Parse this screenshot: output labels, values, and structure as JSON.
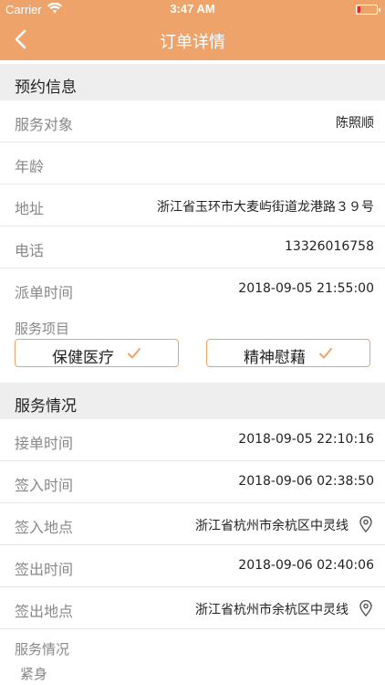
{
  "status_bar": {
    "carrier": "Carrier",
    "time": "3:47 AM",
    "battery_color": "#e2262c"
  },
  "nav": {
    "title": "订单详情",
    "back_icon": "chevron-left-icon",
    "bar_color": "#eda36a"
  },
  "booking": {
    "header": "预约信息",
    "rows": [
      {
        "label": "服务对象",
        "value": "陈照顺"
      },
      {
        "label": "年龄",
        "value": ""
      },
      {
        "label": "地址",
        "value": "浙江省玉环市大麦屿街道龙港路３９号"
      },
      {
        "label": "电话",
        "value": "13326016758"
      },
      {
        "label": "派单时间",
        "value": "2018-09-05 21:55:00"
      }
    ],
    "items_label": "服务项目",
    "items": [
      {
        "label": "保健医疗",
        "checked": true
      },
      {
        "label": "精神慰藉",
        "checked": true
      }
    ]
  },
  "service": {
    "header": "服务情况",
    "rows": [
      {
        "label": "接单时间",
        "value": "2018-09-05 22:10:16"
      },
      {
        "label": "签入时间",
        "value": "2018-09-06 02:38:50"
      },
      {
        "label": "签入地点",
        "value": "浙江省杭州市余杭区中灵线"
      },
      {
        "label": "签出时间",
        "value": "2018-09-06 02:40:06"
      },
      {
        "label": "签出地点",
        "value": "浙江省杭州市余杭区中灵线"
      }
    ],
    "status_label": "服务情况",
    "status_value": "紧身"
  }
}
